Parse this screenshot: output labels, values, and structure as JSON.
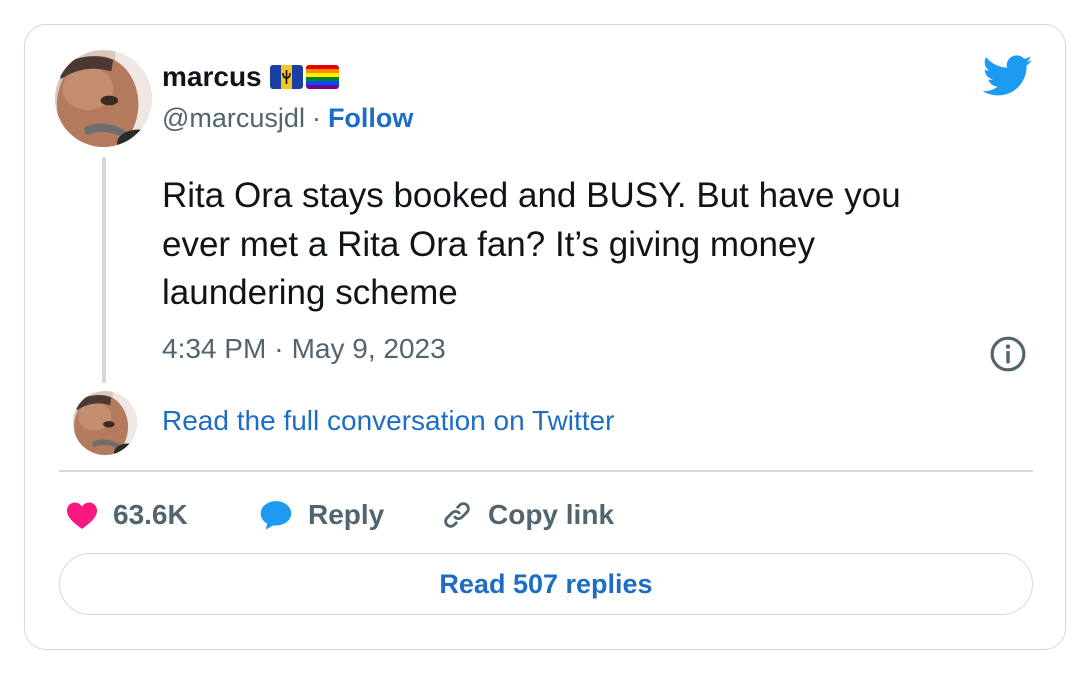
{
  "author": {
    "display_name": "marcus",
    "handle": "@marcusjdl",
    "separator": "·",
    "follow_label": "Follow",
    "flags": [
      "barbados-flag-icon",
      "rainbow-pride-flag-icon"
    ]
  },
  "tweet": {
    "text": "Rita Ora stays booked and BUSY. But have you\never met a Rita Ora fan? It’s giving money\nlaundering scheme",
    "time": "4:34 PM",
    "separator": "·",
    "date": "May 9, 2023"
  },
  "conversation_link": "Read the full conversation on Twitter",
  "actions": {
    "likes_count": "63.6K",
    "reply_label": "Reply",
    "copy_link_label": "Copy link"
  },
  "read_replies_label": "Read 507 replies",
  "colors": {
    "link_blue": "#1d6dc6",
    "twitter_blue": "#1d9bf0",
    "like_pink": "#f91880",
    "muted_text": "#536471",
    "border": "#cfd9de"
  },
  "icons": {
    "brand": "twitter-bird-icon",
    "info": "info-icon",
    "like": "heart-icon",
    "reply": "speech-bubble-icon",
    "copy": "link-icon"
  }
}
